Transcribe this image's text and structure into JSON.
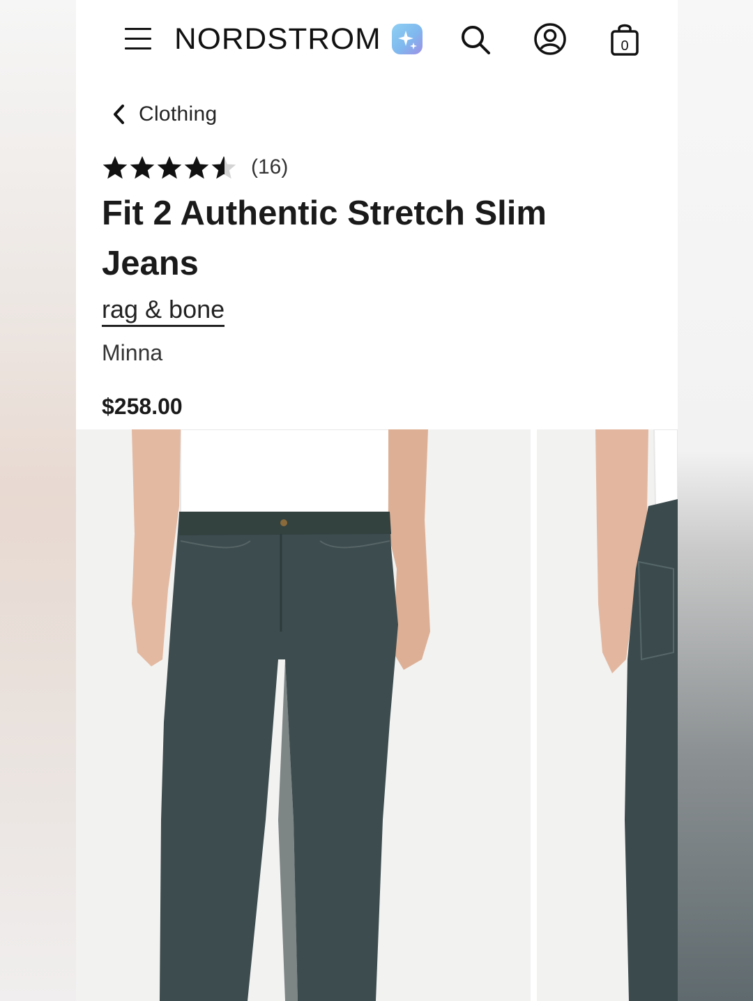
{
  "header": {
    "logo": "NORDSTROM",
    "bag_count": "0",
    "icons": [
      "menu-icon",
      "ai-sparkle-icon",
      "search-icon",
      "account-icon",
      "shopping-bag-icon"
    ]
  },
  "breadcrumb": {
    "label": "Clothing"
  },
  "product": {
    "rating_value": 4.5,
    "rating_max": 5,
    "rating_count": "(16)",
    "title": "Fit 2 Authentic Stretch Slim Jeans",
    "brand": "rag & bone",
    "color": "Minna",
    "price": "$258.00"
  },
  "gallery": {
    "images": [
      {
        "alt": "front view of model wearing dark green-gray slim jeans and white t-shirt"
      },
      {
        "alt": "side view of model wearing jeans"
      }
    ]
  },
  "colors": {
    "text": "#111111",
    "denim": "#3d4c4f",
    "photo_bg": "#f2f2f1"
  }
}
